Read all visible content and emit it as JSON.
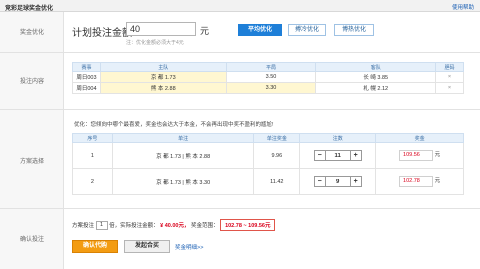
{
  "header": {
    "title": "竞彩足球奖金优化",
    "help": "使用帮助"
  },
  "sections": {
    "optimize": "奖金优化",
    "content": "投注内容",
    "plan": "方案选择",
    "confirm": "确认投注"
  },
  "amount": {
    "label": "计划投注金额",
    "value": "40",
    "unit": "元",
    "hint": "注：优化金额必须大于4元"
  },
  "modes": [
    "平均优化",
    "搏冷优化",
    "博热优化"
  ],
  "active_mode": 0,
  "match_table": {
    "headers": [
      "赛事",
      "主队",
      "平局",
      "客队",
      "胆码"
    ],
    "rows": [
      {
        "id": "周日003",
        "home": "京 都 1.73",
        "draw": "3.50",
        "away": "长 崎 3.85",
        "del": "×"
      },
      {
        "id": "周日004",
        "home": "熊 本 2.88",
        "draw": "3.30",
        "away": "札 幌 2.12",
        "del": "×"
      }
    ]
  },
  "notice": "优化：您倾向中哪个最喜爱，奖金也会达大于本金，不会再出现中奖不盈利的尴尬!",
  "plan_table": {
    "headers": [
      "序号",
      "单注",
      "单注奖金",
      "注数",
      "奖金"
    ],
    "rows": [
      {
        "no": "1",
        "bet": "京 都 1.73 | 熊 本 2.88",
        "single": "9.96",
        "count": "11",
        "bonus": "109.56",
        "unit": "元",
        "minus": "−",
        "plus": "+"
      },
      {
        "no": "2",
        "bet": "京 都 1.73 | 熊 本 3.30",
        "single": "11.42",
        "count": "9",
        "bonus": "102.78",
        "unit": "元",
        "minus": "−",
        "plus": "+"
      }
    ]
  },
  "confirm": {
    "mult_label": "方案投注",
    "mult_value": "1",
    "mult_suffix": "倍，实际投注金额：",
    "amount": "¥ 40.00元，",
    "range_label": "奖金范围：",
    "range": "102.78 ~ 109.56元",
    "buy": "确认代购",
    "syndicate": "发起合买",
    "detail_link": "奖金明细>>"
  }
}
